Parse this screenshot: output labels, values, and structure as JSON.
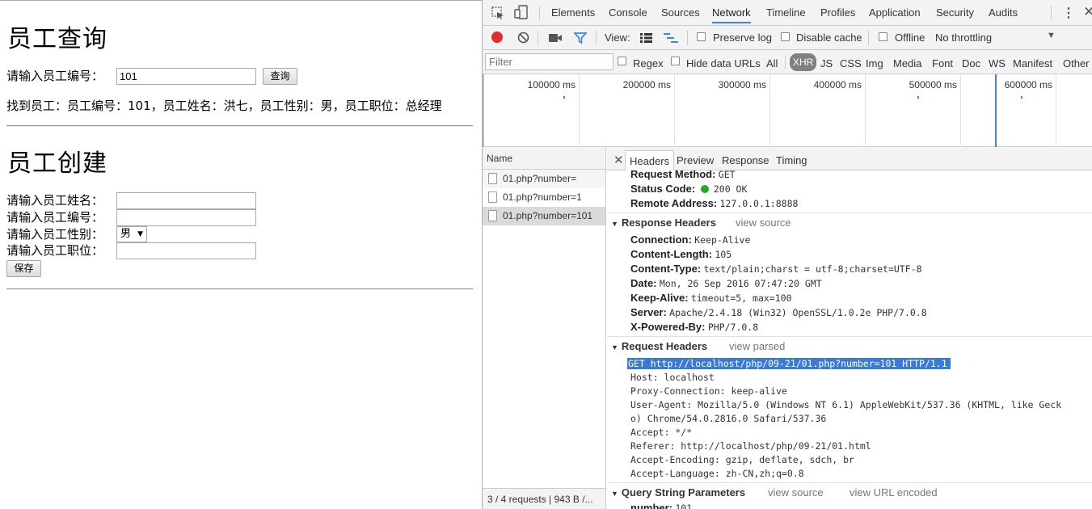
{
  "page": {
    "query_title": "员工查询",
    "query_label": "请输入员工编号：",
    "query_value": "101",
    "query_button": "查询",
    "result_text": "找到员工：员工编号：101，员工姓名：洪七，员工性别：男，员工职位：总经理",
    "create_title": "员工创建",
    "name_label": "请输入员工姓名：",
    "number_label": "请输入员工编号：",
    "gender_label": "请输入员工性别：",
    "gender_selected": "男",
    "position_label": "请输入员工职位：",
    "save_button": "保存"
  },
  "devtools": {
    "tabs": [
      "Elements",
      "Console",
      "Sources",
      "Network",
      "Timeline",
      "Profiles",
      "Application",
      "Security",
      "Audits"
    ],
    "active_tab": "Network",
    "toolbar": {
      "view_label": "View:",
      "preserve_log": "Preserve log",
      "disable_cache": "Disable cache",
      "offline": "Offline",
      "throttling": "No throttling"
    },
    "filter": {
      "placeholder": "Filter",
      "regex": "Regex",
      "hide_data_urls": "Hide data URLs",
      "types": [
        "All",
        "XHR",
        "JS",
        "CSS",
        "Img",
        "Media",
        "Font",
        "Doc",
        "WS",
        "Manifest",
        "Other"
      ],
      "active_type": "XHR"
    },
    "timeline_ticks": [
      "100000 ms",
      "200000 ms",
      "300000 ms",
      "400000 ms",
      "500000 ms",
      "600000 ms"
    ],
    "request_list": {
      "header": "Name",
      "items": [
        "01.php?number=",
        "01.php?number=1",
        "01.php?number=101"
      ],
      "status": "3 / 4 requests  |  943 B /..."
    },
    "detail_tabs": [
      "Headers",
      "Preview",
      "Response",
      "Timing"
    ],
    "general": {
      "method_label": "Request Method:",
      "method": "GET",
      "status_label": "Status Code:",
      "status": "200 OK",
      "remote_label": "Remote Address:",
      "remote": "127.0.0.1:8888"
    },
    "response_headers": {
      "title": "Response Headers",
      "link": "view source",
      "rows": [
        {
          "k": "Connection:",
          "v": "Keep-Alive"
        },
        {
          "k": "Content-Length:",
          "v": "105"
        },
        {
          "k": "Content-Type:",
          "v": "text/plain;charst = utf-8;charset=UTF-8"
        },
        {
          "k": "Date:",
          "v": "Mon, 26 Sep 2016 07:47:20 GMT"
        },
        {
          "k": "Keep-Alive:",
          "v": "timeout=5, max=100"
        },
        {
          "k": "Server:",
          "v": "Apache/2.4.18 (Win32) OpenSSL/1.0.2e PHP/7.0.8"
        },
        {
          "k": "X-Powered-By:",
          "v": "PHP/7.0.8"
        }
      ]
    },
    "request_headers": {
      "title": "Request Headers",
      "link": "view parsed",
      "lines": [
        "GET http://localhost/php/09-21/01.php?number=101 HTTP/1.1",
        "Host: localhost",
        "Proxy-Connection: keep-alive",
        "User-Agent: Mozilla/5.0 (Windows NT 6.1) AppleWebKit/537.36 (KHTML, like Geck",
        "o) Chrome/54.0.2816.0 Safari/537.36",
        "Accept: */*",
        "Referer: http://localhost/php/09-21/01.html",
        "Accept-Encoding: gzip, deflate, sdch, br",
        "Accept-Language: zh-CN,zh;q=0.8"
      ]
    },
    "query_params": {
      "title": "Query String Parameters",
      "link1": "view source",
      "link2": "view URL encoded",
      "row_key": "number:",
      "row_value": "101"
    },
    "colors": {
      "accent": "#3e82f7",
      "record": "#e32b2b",
      "status_ok": "#2aa52a",
      "highlight": "#3879d9"
    }
  }
}
